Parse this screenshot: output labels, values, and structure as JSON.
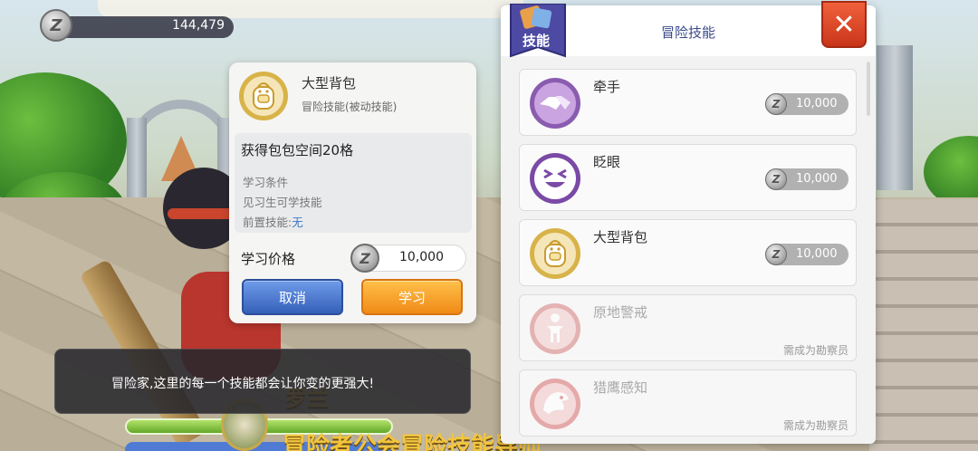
{
  "currency": {
    "amount": "144,479",
    "icon": "zeny-coin-icon",
    "symbol": "Z"
  },
  "skill_detail": {
    "name": "大型背包",
    "type": "冒险技能(被动技能)",
    "effect": "获得包包空间20格",
    "conditions_title": "学习条件",
    "condition_1": "见习生可学技能",
    "prereq_label": "前置技能:",
    "prereq_value": "无",
    "price_label": "学习价格",
    "price": "10,000",
    "cancel_label": "取消",
    "learn_label": "学习"
  },
  "dialog": {
    "text": "冒险家,这里的每一个技能都会让你变的更强大!"
  },
  "scene": {
    "npc_name": "罗兰",
    "npc_title": "冒险者公会冒险技能导师"
  },
  "panel": {
    "tab_label": "技能",
    "title": "冒险技能",
    "close_symbol": "✕",
    "skills": [
      {
        "name": "牵手",
        "cost": "10,000",
        "icon": "handshake-icon",
        "locked": false
      },
      {
        "name": "眨眼",
        "cost": "10,000",
        "icon": "wink-face-icon",
        "locked": false
      },
      {
        "name": "大型背包",
        "cost": "10,000",
        "icon": "backpack-icon",
        "locked": false
      },
      {
        "name": "原地警戒",
        "requirement": "需成为勘察员",
        "icon": "standing-guard-icon",
        "locked": true
      },
      {
        "name": "猎鹰感知",
        "requirement": "需成为勘察员",
        "icon": "falcon-icon",
        "locked": true
      }
    ]
  },
  "colors": {
    "accent_blue": "#3560b8",
    "accent_orange": "#f08a17",
    "close_red": "#d9401f",
    "prereq_blue": "#3b77c6",
    "skill_icon_purple": "#8a5cb0"
  }
}
